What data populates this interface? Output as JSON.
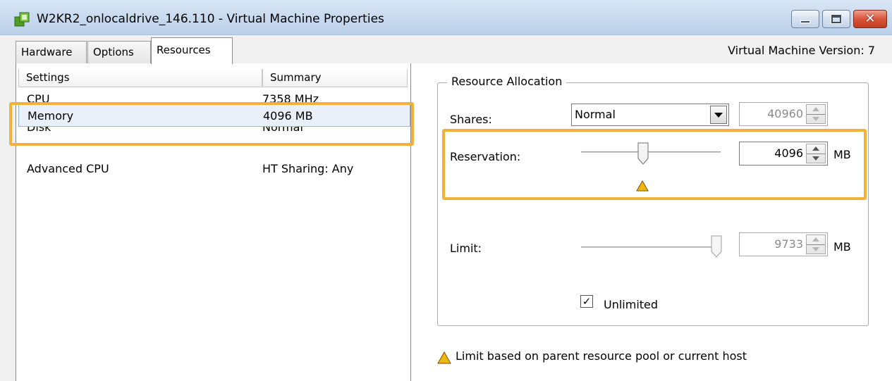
{
  "window": {
    "title": "W2KR2_onlocaldrive_146.110 - Virtual Machine Properties"
  },
  "tabs": [
    {
      "label": "Hardware",
      "selected": false
    },
    {
      "label": "Options",
      "selected": false
    },
    {
      "label": "Resources",
      "selected": true
    }
  ],
  "vm_version": "Virtual Machine Version: 7",
  "settings_list": {
    "headers": {
      "settings": "Settings",
      "summary": "Summary"
    },
    "rows": [
      {
        "setting": "CPU",
        "summary": "7358 MHz"
      },
      {
        "setting": "Memory",
        "summary": "4096 MB",
        "selected": true
      },
      {
        "setting": "Disk",
        "summary": "Normal"
      },
      {
        "setting": "Advanced CPU",
        "summary": "HT Sharing: Any"
      }
    ]
  },
  "resource_allocation": {
    "legend": "Resource Allocation",
    "shares": {
      "label": "Shares:",
      "selected": "Normal",
      "value": "40960"
    },
    "reservation": {
      "label": "Reservation:",
      "value": "4096",
      "unit": "MB",
      "slider_fraction": 0.44
    },
    "limit": {
      "label": "Limit:",
      "value": "9733",
      "unit": "MB",
      "slider_fraction": 1.0
    },
    "unlimited": {
      "label": "Unlimited",
      "checked": true
    }
  },
  "note": "Limit based on parent resource pool or current host",
  "colors": {
    "highlight": "#f4b13a",
    "warning_fill": "#f2b70d",
    "selection_bg": "#e9f0f9"
  }
}
